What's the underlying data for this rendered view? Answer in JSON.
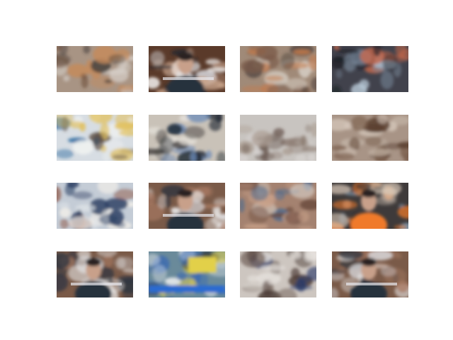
{
  "figure": {
    "rows": 4,
    "cols": 4,
    "background": "#ffffff",
    "tiles": [
      {
        "id": 1,
        "base": "#a89484",
        "accents": [
          "#6b4a36",
          "#c58a5a",
          "#d8d2cc",
          "#3a3430"
        ],
        "kind": "crowd"
      },
      {
        "id": 2,
        "base": "#5a3a2a",
        "accents": [
          "#e2e6ec",
          "#1e2430",
          "#c7a28a",
          "#ffffff"
        ],
        "kind": "portrait-man"
      },
      {
        "id": 3,
        "base": "#a08a78",
        "accents": [
          "#c67a4a",
          "#d9d2c8",
          "#7a5a48",
          "#3c3431"
        ],
        "kind": "crowd"
      },
      {
        "id": 4,
        "base": "#41424c",
        "accents": [
          "#b8c8d6",
          "#7e8fa2",
          "#d06a4a",
          "#1a1c24"
        ],
        "kind": "street"
      },
      {
        "id": 5,
        "base": "#d7dde3",
        "accents": [
          "#f2f4f2",
          "#5a4a40",
          "#2a6aa0",
          "#e2c05a"
        ],
        "kind": "masked-person"
      },
      {
        "id": 6,
        "base": "#c9c2b8",
        "accents": [
          "#1b2430",
          "#6a8ab8",
          "#e6e2dc",
          "#3d3a38"
        ],
        "kind": "office"
      },
      {
        "id": 7,
        "base": "#c8c4c0",
        "accents": [
          "#a89a8e",
          "#6a5a52",
          "#d8d4d2",
          "#8a7a70"
        ],
        "kind": "blurred"
      },
      {
        "id": 8,
        "base": "#a89486",
        "accents": [
          "#5a4030",
          "#d6c8bc",
          "#7a5e4c",
          "#c0b0a2"
        ],
        "kind": "blurred"
      },
      {
        "id": 9,
        "base": "#c4ccd6",
        "accents": [
          "#2a3e62",
          "#e2e6ea",
          "#8a4a36",
          "#f4f0ea"
        ],
        "kind": "masked-group"
      },
      {
        "id": 10,
        "base": "#7a5a48",
        "accents": [
          "#2e3440",
          "#d8d8dc",
          "#a87a62",
          "#f0f0f0"
        ],
        "kind": "portrait-man"
      },
      {
        "id": 11,
        "base": "#a48270",
        "accents": [
          "#4a6a90",
          "#c8a088",
          "#6a4a3e",
          "#d8d0c8"
        ],
        "kind": "crowd"
      },
      {
        "id": 12,
        "base": "#3e3a3a",
        "accents": [
          "#f07a2a",
          "#d8c8b8",
          "#1e1e24",
          "#8aa8c0"
        ],
        "kind": "portrait-orange"
      },
      {
        "id": 13,
        "base": "#7a5a48",
        "accents": [
          "#2e3440",
          "#d8d8dc",
          "#a87a62",
          "#f0f0f0"
        ],
        "kind": "portrait-man"
      },
      {
        "id": 14,
        "base": "#6a8a9a",
        "accents": [
          "#e2d04a",
          "#3a6ab0",
          "#f2f2f2",
          "#2a2a2a"
        ],
        "kind": "tv-studio"
      },
      {
        "id": 15,
        "base": "#cdc6c0",
        "accents": [
          "#4a3a34",
          "#7a6a62",
          "#2a3a6a",
          "#e8e4e0"
        ],
        "kind": "blurred"
      },
      {
        "id": 16,
        "base": "#7a5a48",
        "accents": [
          "#2e3440",
          "#d8d8dc",
          "#a87a62",
          "#f0f0f0"
        ],
        "kind": "portrait-man"
      }
    ]
  }
}
